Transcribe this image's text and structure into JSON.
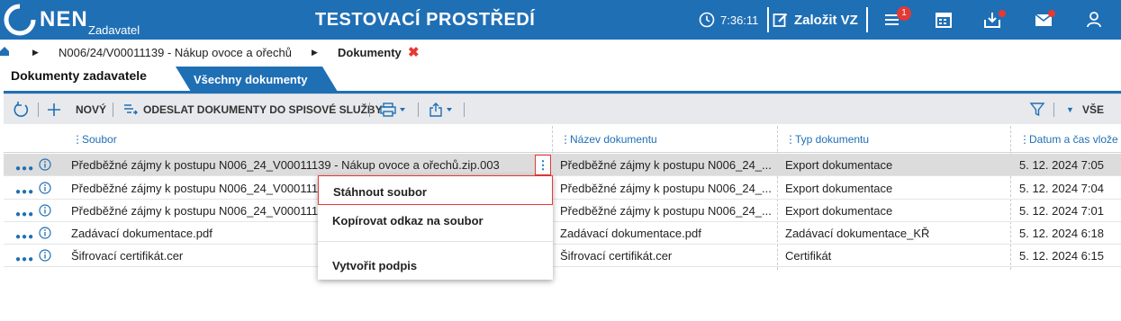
{
  "topbar": {
    "brand": "NEN",
    "brand_sub": "Zadavatel",
    "environment": "TESTOVACÍ PROSTŘEDÍ",
    "time": "7:36:11",
    "create_label": "Založit VZ",
    "notification_count": "1",
    "colors": {
      "bar": "#1f6fb5",
      "badge": "#e53935"
    }
  },
  "breadcrumb": {
    "items": [
      "N006/24/V00011139 - Nákup ovoce a ořechů",
      "Dokumenty"
    ]
  },
  "tabs": [
    {
      "label": "Dokumenty zadavatele",
      "active": true
    },
    {
      "label": "Všechny dokumenty",
      "active": false
    }
  ],
  "toolbar": {
    "new_label": "NOVÝ",
    "send_label": "ODESLAT DOKUMENTY DO SPISOVÉ SLUŽBY",
    "filter_value": "VŠE"
  },
  "table": {
    "columns": [
      "Soubor",
      "Název dokumentu",
      "Typ dokumentu",
      "Datum a čas vlože"
    ],
    "rows": [
      {
        "file": "Předběžné zájmy k postupu N006_24_V00011139 - Nákup ovoce a ořechů.zip.003",
        "name": "Předběžné zájmy k postupu N006_24_...",
        "type": "Export dokumentace",
        "date": "5. 12. 2024 7:05",
        "selected": true
      },
      {
        "file": "Předběžné zájmy k postupu N006_24_V00011139 - Nákup ovoce a ořechů.zip.002",
        "name": "Předběžné zájmy k postupu N006_24_...",
        "type": "Export dokumentace",
        "date": "5. 12. 2024 7:04",
        "selected": false
      },
      {
        "file": "Předběžné zájmy k postupu N006_24_V00011139 - Nákup ovoce a ořechů.zip.001",
        "name": "Předběžné zájmy k postupu N006_24_...",
        "type": "Export dokumentace",
        "date": "5. 12. 2024 7:01",
        "selected": false
      },
      {
        "file": "Zadávací dokumentace.pdf",
        "name": "Zadávací dokumentace.pdf",
        "type": "Zadávací dokumentace_KŘ",
        "date": "5. 12. 2024 6:18",
        "selected": false
      },
      {
        "file": "Šifrovací certifikát.cer",
        "name": "Šifrovací certifikát.cer",
        "type": "Certifikát",
        "date": "5. 12. 2024 6:15",
        "selected": false
      }
    ]
  },
  "context_menu": {
    "items": [
      "Stáhnout soubor",
      "Kopírovat odkaz na soubor",
      "Vytvořit podpis"
    ]
  }
}
